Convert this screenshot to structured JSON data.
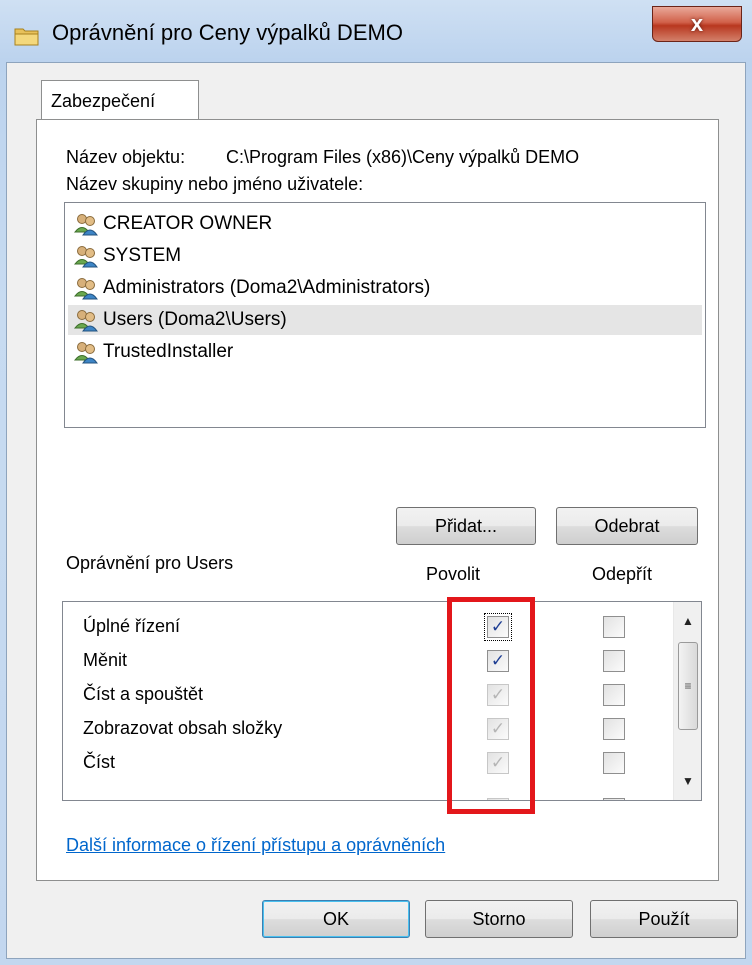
{
  "window": {
    "title": "Oprávnění pro Ceny výpalků DEMO",
    "close_label": "x"
  },
  "tab": {
    "label": "Zabezpečení"
  },
  "object": {
    "name_label": "Název objektu:",
    "path": "C:\\Program Files (x86)\\Ceny výpalků DEMO"
  },
  "principals": {
    "label": "Název skupiny nebo jméno uživatele:",
    "items": [
      {
        "label": "CREATOR OWNER",
        "icon": "user-group-icon"
      },
      {
        "label": "SYSTEM",
        "icon": "user-group-icon"
      },
      {
        "label": "Administrators (Doma2\\Administrators)",
        "icon": "user-group-icon"
      },
      {
        "label": "Users (Doma2\\Users)",
        "icon": "user-group-icon",
        "selected": true
      },
      {
        "label": "TrustedInstaller",
        "icon": "user-group-icon"
      }
    ]
  },
  "buttons": {
    "add": "Přidat...",
    "remove": "Odebrat",
    "ok": "OK",
    "cancel": "Storno",
    "apply": "Použít"
  },
  "permissions": {
    "label": "Oprávnění pro Users",
    "allow_header": "Povolit",
    "deny_header": "Odepřít",
    "rows": [
      {
        "name": "Úplné řízení",
        "allow": "checked",
        "deny": "unchecked"
      },
      {
        "name": "Měnit",
        "allow": "checked",
        "deny": "unchecked"
      },
      {
        "name": "Číst a spouštět",
        "allow": "inherited",
        "deny": "unchecked"
      },
      {
        "name": "Zobrazovat obsah složky",
        "allow": "inherited",
        "deny": "unchecked"
      },
      {
        "name": "Číst",
        "allow": "inherited",
        "deny": "unchecked"
      }
    ]
  },
  "help_link": "Další informace o řízení přístupu a oprávněních",
  "colors": {
    "highlight": "#e3171b",
    "link": "#0066cc",
    "selection": "#e5e5e5"
  }
}
